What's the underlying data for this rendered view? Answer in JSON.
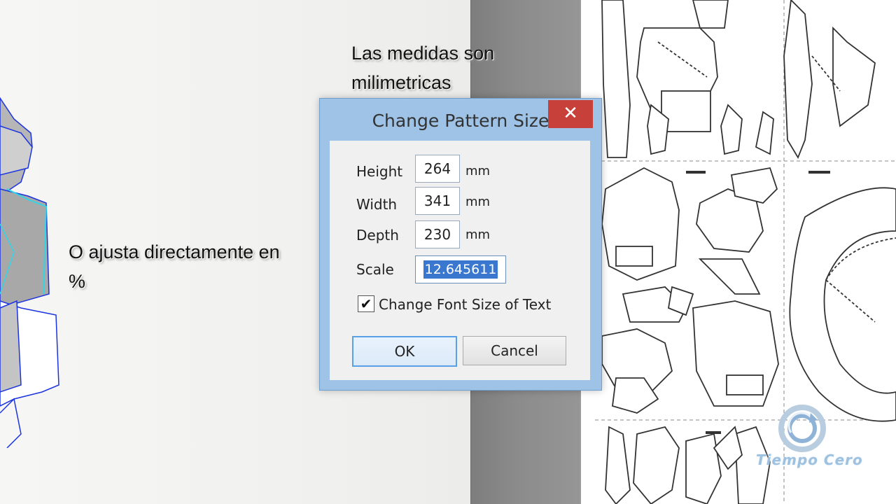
{
  "captions": {
    "top": "Las medidas son milimetricas",
    "left": "O ajusta directamente en %"
  },
  "dialog": {
    "title": "Change Pattern Size",
    "close_label": "✕",
    "fields": {
      "height": {
        "label": "Height",
        "value": "264",
        "unit": "mm"
      },
      "width": {
        "label": "Width",
        "value": "341",
        "unit": "mm"
      },
      "depth": {
        "label": "Depth",
        "value": "230",
        "unit": "mm"
      },
      "scale": {
        "label": "Scale",
        "value": "12.645611"
      }
    },
    "checkbox": {
      "label": "Change Font Size of Text",
      "checked": true,
      "mark": "✔"
    },
    "buttons": {
      "ok": "OK",
      "cancel": "Cancel"
    }
  },
  "logo": {
    "text": "Tiempo Cero"
  },
  "colors": {
    "dialog_frame": "#9ec3e6",
    "close_button": "#c8403a",
    "selection": "#3a78d0",
    "model_wire": "#1c33e0",
    "model_highlight": "#2fd6e6"
  }
}
